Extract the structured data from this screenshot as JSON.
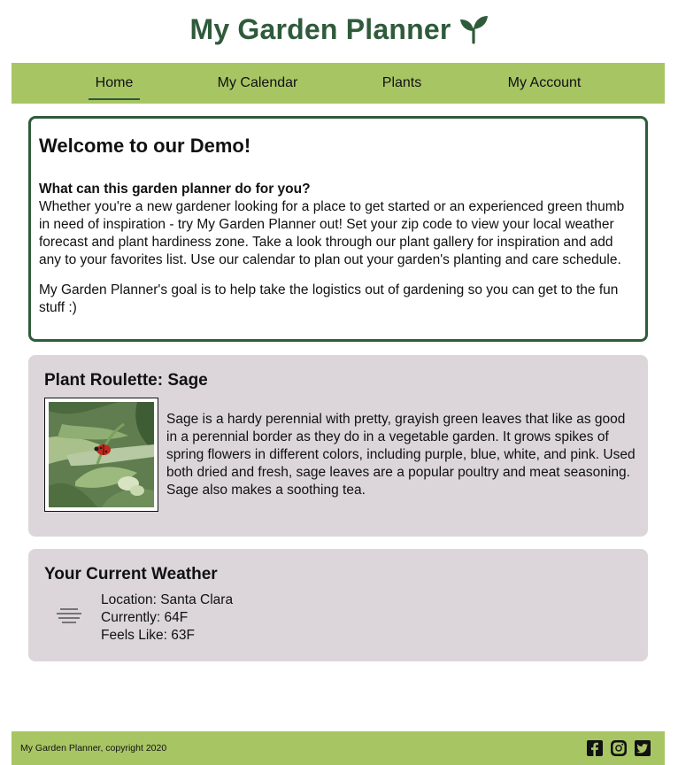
{
  "header": {
    "title": "My Garden Planner"
  },
  "nav": {
    "items": [
      {
        "label": "Home",
        "active": true
      },
      {
        "label": "My Calendar",
        "active": false
      },
      {
        "label": "Plants",
        "active": false
      },
      {
        "label": "My Account",
        "active": false
      }
    ]
  },
  "welcome": {
    "heading": "Welcome to our Demo!",
    "question": "What can this garden planner do for you?",
    "paragraph1": "Whether you're a new gardener looking for a place to get started or an experienced green thumb in need of inspiration - try My Garden Planner out! Set your zip code to view your local weather forecast and plant hardiness zone. Take a look through our plant gallery for inspiration and add any to your favorites list. Use our calendar to plan out your garden's planting and care schedule.",
    "paragraph2": "My Garden Planner's goal is to help take the logistics out of gardening so you can get to the fun stuff :)"
  },
  "roulette": {
    "title": "Plant Roulette: Sage",
    "description": "Sage is a hardy perennial with pretty, grayish green leaves that like as good in a perennial border as they do in a vegetable garden. It grows spikes of spring flowers in different colors, including purple, blue, white, and pink. Used both dried and fresh, sage leaves are a popular poultry and meat seasoning. Sage also makes a soothing tea."
  },
  "weather": {
    "title": "Your Current Weather",
    "icon": "fog-icon",
    "location": "Location: Santa Clara",
    "currently": "Currently: 64F",
    "feels_like": "Feels Like: 63F"
  },
  "footer": {
    "copyright": "My Garden Planner, copyright 2020",
    "social": [
      "facebook-icon",
      "instagram-icon",
      "twitter-icon"
    ]
  },
  "colors": {
    "brand_green": "#2f5b3b",
    "nav_green": "#a8c564",
    "card_bg": "#dcd6da"
  }
}
